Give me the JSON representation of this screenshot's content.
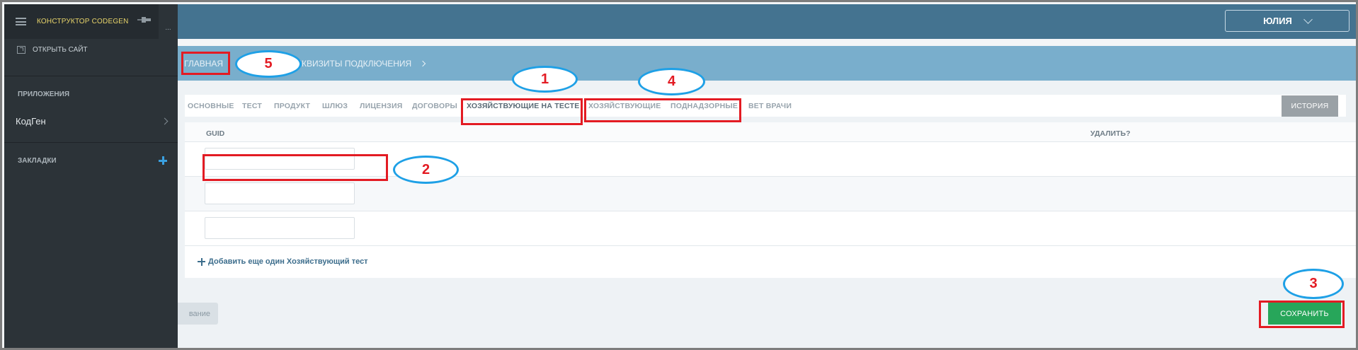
{
  "sidebar": {
    "app_title": "КОНСТРУКТОР CODEGEN",
    "pin_tab_label": "...",
    "open_site": "ОТКРЫТЬ САЙТ",
    "apps_section": "ПРИЛОЖЕНИЯ",
    "apps": [
      {
        "label": "КодГен"
      }
    ],
    "bookmarks_section": "ЗАКЛАДКИ"
  },
  "header": {
    "user_name": "ЮЛИЯ"
  },
  "breadcrumb": {
    "home": "ГЛАВНАЯ",
    "current": "РЕКВИЗИТЫ ПОДКЛЮЧЕНИЯ"
  },
  "tabs": [
    {
      "label": "ОСНОВНЫЕ"
    },
    {
      "label": "ТЕСТ"
    },
    {
      "label": "ПРОДУКТ"
    },
    {
      "label": "ШЛЮЗ"
    },
    {
      "label": "ЛИЦЕНЗИЯ"
    },
    {
      "label": "ДОГОВОРЫ"
    },
    {
      "label": "ХОЗЯЙСТВУЮЩИЕ НА ТЕСТЕ",
      "active": true
    },
    {
      "label": "ХОЗЯЙСТВУЮЩИЕ"
    },
    {
      "label": "ПОДНАДЗОРНЫЕ"
    },
    {
      "label": "ВЕТ ВРАЧИ"
    }
  ],
  "history_button": "ИСТОРИЯ",
  "table": {
    "columns": [
      "GUID",
      "УДАЛИТЬ?"
    ],
    "rows": [
      {
        "guid": ""
      },
      {
        "guid": ""
      },
      {
        "guid": ""
      }
    ]
  },
  "add_link": "Добавить еще один Хозяйствующий тест",
  "footer": {
    "left_button": "вание",
    "save_button": "СОХРАНИТЬ"
  },
  "annotations": [
    {
      "number": "1",
      "target": "tab-hozyaystvuyushchie-na-teste"
    },
    {
      "number": "2",
      "target": "guid-input-row-1"
    },
    {
      "number": "3",
      "target": "save-button"
    },
    {
      "number": "4",
      "target": "tabs-hozyaystvuyushchie-podnadzornye"
    },
    {
      "number": "5",
      "target": "breadcrumb-home"
    }
  ],
  "colors": {
    "header_bg": "#447390",
    "breadcrumb_bg": "#79aecc",
    "sidebar_bg": "#2c3338",
    "save_green": "#27a65a",
    "annotation_red": "#e31b23",
    "annotation_blue": "#1ea0e6"
  }
}
